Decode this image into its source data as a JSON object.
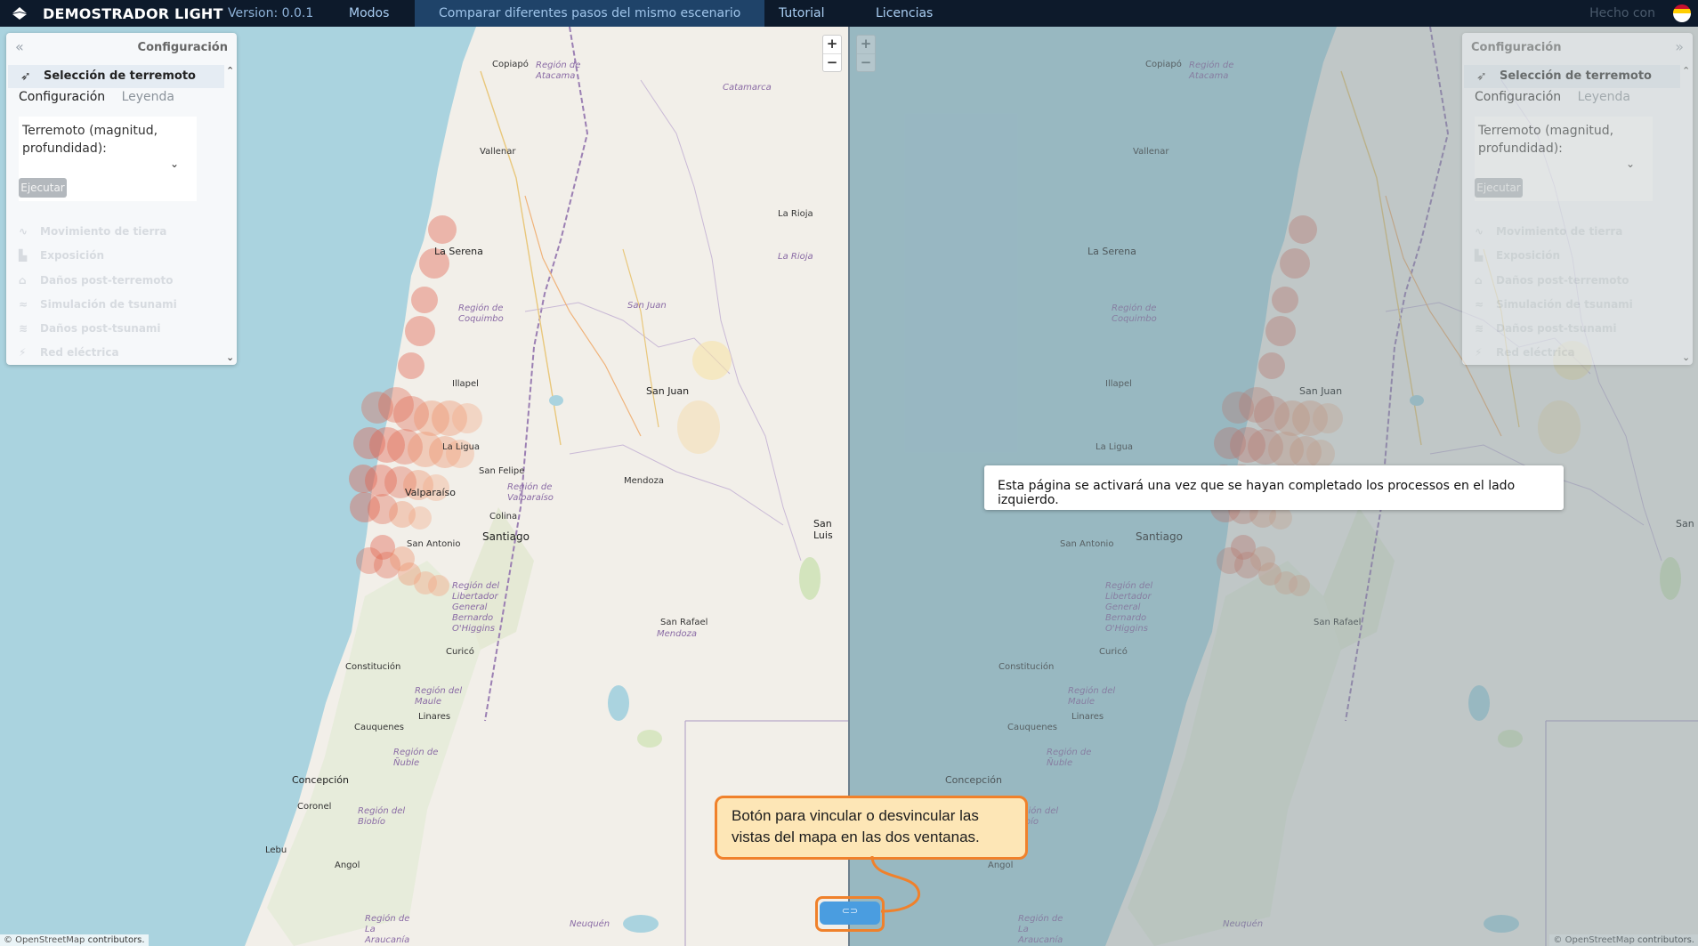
{
  "topbar": {
    "brand": "DEMOSTRADOR LIGHT",
    "version": "Version: 0.0.1",
    "nav": [
      {
        "label": "Modos",
        "active": false
      },
      {
        "label": "Comparar diferentes pasos del mismo escenario",
        "active": true
      },
      {
        "label": "Tutorial",
        "active": false
      },
      {
        "label": "Licencias",
        "active": false
      }
    ],
    "made_with": "Hecho con"
  },
  "panel": {
    "title": "Configuración",
    "selected_step": "Selección de terremoto",
    "tabs": [
      "Configuración",
      "Leyenda"
    ],
    "earthquake_label": "Terremoto (magnitud, profundidad):",
    "run_button": "Ejecutar",
    "steps": [
      {
        "label": "Movimiento de tierra",
        "icon": "seismograph-icon"
      },
      {
        "label": "Exposición",
        "icon": "building-icon"
      },
      {
        "label": "Daños post-terremoto",
        "icon": "damage-icon"
      },
      {
        "label": "Simulación de tsunami",
        "icon": "wave-icon"
      },
      {
        "label": "Daños post-tsunami",
        "icon": "wave-damage-icon"
      },
      {
        "label": "Red eléctrica",
        "icon": "power-icon"
      }
    ]
  },
  "map": {
    "zoom_in": "+",
    "zoom_out": "−",
    "attribution_prefix": "© OpenStreetMap",
    "attribution_suffix": "contributors.",
    "labels": {
      "copiapo": "Copiapó",
      "region_atacama": "Región de Atacama",
      "catamarca": "Catamarca",
      "vallenar": "Vallenar",
      "la_rioja_city": "La Rioja",
      "la_rioja_prov": "La Rioja",
      "la_serena": "La Serena",
      "region_coquimbo": "Región de Coquimbo",
      "san_juan_prov": "San Juan",
      "illapel": "Illapel",
      "san_juan_city": "San Juan",
      "la_ligua": "La Ligua",
      "san_felipe": "San Felipe",
      "mendoza": "Mendoza",
      "region_valparaiso": "Región de Valparaíso",
      "valparaiso": "Valparaíso",
      "colina": "Colina",
      "san_luis": "San Luis",
      "santiago": "Santiago",
      "san_antonio": "San Antonio",
      "region_ohiggins": "Región del Libertador General Bernardo O'Higgins",
      "san_rafael": "San Rafael",
      "mendoza_prov": "Mendoza",
      "constitucion": "Constitución",
      "curico": "Curicó",
      "region_maule": "Región del Maule",
      "linares": "Linares",
      "cauquenes": "Cauquenes",
      "region_nuble": "Región de Ñuble",
      "concepcion": "Concepción",
      "coronel": "Coronel",
      "region_biobio": "Región del Biobío",
      "lebu": "Lebu",
      "angol": "Angol",
      "region_araucania": "Región de La Araucanía",
      "neuquen": "Neuquén"
    }
  },
  "right_message": "Esta página se activará una vez que se hayan completado los processos en el lado izquierdo.",
  "callout": "Botón para vincular o desvincular las vistas del mapa en las dos ventanas.",
  "colors": {
    "topbar": "#0d1a2b",
    "active_tab": "#1f4369",
    "sea": "#aad3df",
    "land": "#f2efe9",
    "quake": "#e0604a",
    "callout_border": "#f0812b",
    "callout_fill": "#fde6b6",
    "link_button": "#4a9de0"
  }
}
